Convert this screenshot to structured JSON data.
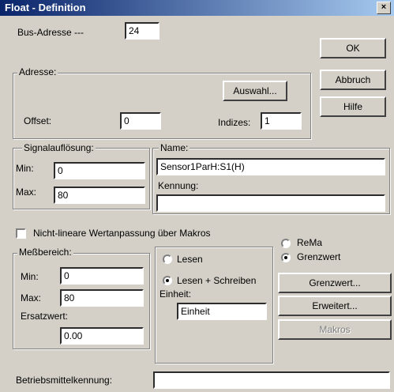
{
  "window": {
    "title": "Float - Definition",
    "close_glyph": "×"
  },
  "bus_address": {
    "label": "Bus-Adresse ---",
    "value": "24"
  },
  "adresse_group": {
    "title": "Adresse:",
    "auswahl_button": "Auswahl...",
    "offset_label": "Offset:",
    "offset_value": "0",
    "indizes_label": "Indizes:",
    "indizes_value": "1"
  },
  "buttons": {
    "ok": "OK",
    "abbruch": "Abbruch",
    "hilfe": "Hilfe"
  },
  "signal_group": {
    "title": "Signalauflösung:",
    "min_label": "Min:",
    "min_value": "0",
    "max_label": "Max:",
    "max_value": "80"
  },
  "name_group": {
    "title": "Name:",
    "name_value": "Sensor1ParH:S1(H)",
    "kennung_label": "Kennung:",
    "kennung_value": ""
  },
  "nonlinear_checkbox": {
    "label": "Nicht-lineare Wertanpassung über Makros",
    "checked": false
  },
  "messbereich_group": {
    "title": "Meßbereich:",
    "min_label": "Min:",
    "min_value": "0",
    "max_label": "Max:",
    "max_value": "80",
    "ersatz_label": "Ersatzwert:",
    "ersatz_value": "0.00"
  },
  "access_group": {
    "lesen_label": "Lesen",
    "lesen_schreiben_label": "Lesen + Schreiben",
    "einheit_label": "Einheit:",
    "einheit_value": "Einheit"
  },
  "mode_radios": {
    "rema_label": "ReMa",
    "grenzwert_label": "Grenzwert"
  },
  "side_buttons": {
    "grenzwert": "Grenzwert...",
    "erweitert": "Erweitert...",
    "makros": "Makros"
  },
  "betriebsmittel": {
    "label": "Betriebsmittelkennung:",
    "value": ""
  }
}
